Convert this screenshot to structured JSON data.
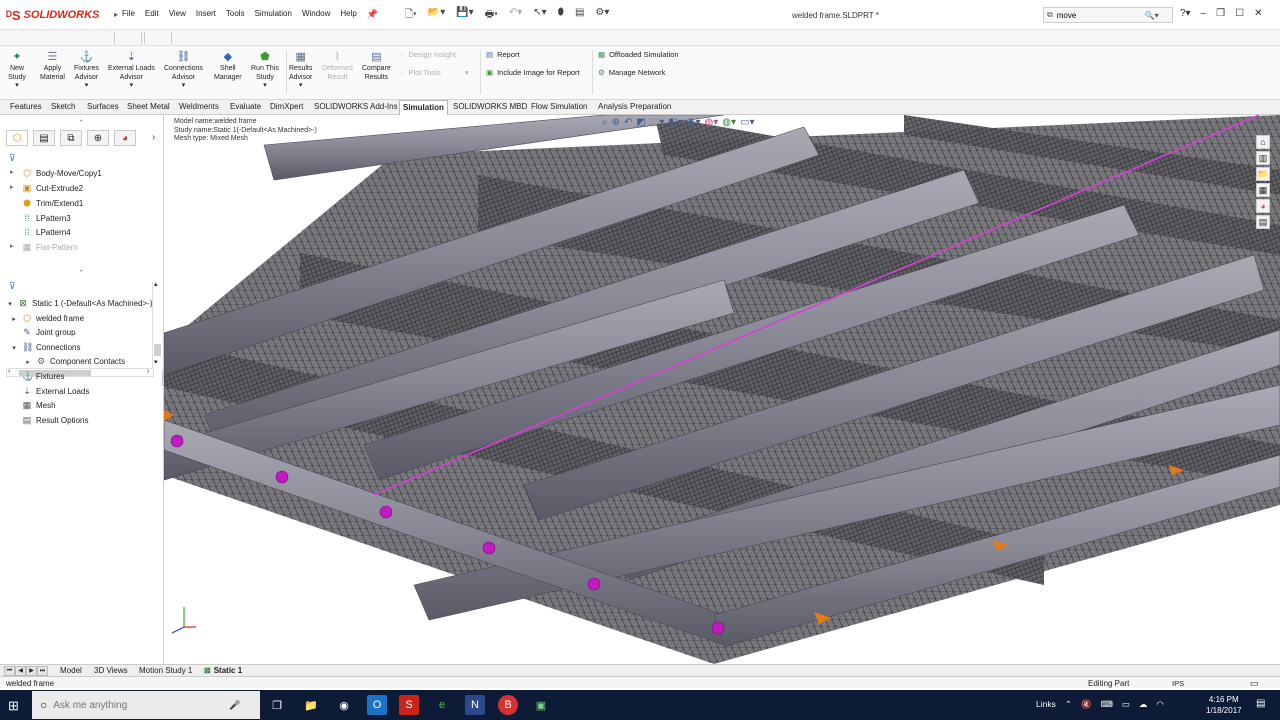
{
  "app": {
    "brand": "SOLIDWORKS",
    "brand_color": "#d52b1e",
    "doc_title": "welded frame.SLDPRT *"
  },
  "menu": [
    "File",
    "Edit",
    "View",
    "Insert",
    "Tools",
    "Simulation",
    "Window",
    "Help"
  ],
  "search": {
    "value": "move"
  },
  "ribbon": {
    "buttons": [
      {
        "label1": "New",
        "label2": "Study",
        "icon": "new-study-icon",
        "disabled": false
      },
      {
        "label1": "Apply",
        "label2": "Material",
        "icon": "apply-material-icon",
        "disabled": false
      },
      {
        "label1": "Fixtures",
        "label2": "Advisor",
        "icon": "fixtures-advisor-icon",
        "disabled": false
      },
      {
        "label1": "External Loads",
        "label2": "Advisor",
        "icon": "external-loads-advisor-icon",
        "disabled": false
      },
      {
        "label1": "Connections",
        "label2": "Advisor",
        "icon": "connections-advisor-icon",
        "disabled": false
      },
      {
        "label1": "Shell",
        "label2": "Manager",
        "icon": "shell-manager-icon",
        "disabled": false
      },
      {
        "label1": "Run This",
        "label2": "Study",
        "icon": "run-study-icon",
        "disabled": false
      },
      {
        "label1": "Results",
        "label2": "Advisor",
        "icon": "results-advisor-icon",
        "disabled": false
      },
      {
        "label1": "Deformed",
        "label2": "Result",
        "icon": "deformed-result-icon",
        "disabled": true
      },
      {
        "label1": "Compare",
        "label2": "Results",
        "icon": "compare-results-icon",
        "disabled": false
      }
    ],
    "small": [
      {
        "label": "Design Insight",
        "icon": "design-insight-icon",
        "disabled": true
      },
      {
        "label": "Plot Tools",
        "icon": "plot-tools-icon",
        "disabled": true
      },
      {
        "label": "Report",
        "icon": "report-icon",
        "disabled": false
      },
      {
        "label": "Include Image for Report",
        "icon": "include-image-icon",
        "disabled": false
      },
      {
        "label": "Offloaded Simulation",
        "icon": "offloaded-simulation-icon",
        "disabled": false
      },
      {
        "label": "Manage Network",
        "icon": "manage-network-icon",
        "disabled": false
      }
    ]
  },
  "tabs": [
    "Features",
    "Sketch",
    "Surfaces",
    "Sheet Metal",
    "Weldments",
    "Evaluate",
    "DimXpert",
    "SOLIDWORKS Add-Ins",
    "Simulation",
    "SOLIDWORKS MBD",
    "Flow Simulation",
    "Analysis Preparation"
  ],
  "tree_features": [
    {
      "label": "Body-Move/Copy1",
      "icon": "body-move-icon",
      "dim": false
    },
    {
      "label": "Cut-Extrude2",
      "icon": "cut-extrude-icon",
      "dim": false
    },
    {
      "label": "Trim/Extend1",
      "icon": "trim-extend-icon",
      "dim": false
    },
    {
      "label": "LPattern3",
      "icon": "linear-pattern-icon",
      "dim": false
    },
    {
      "label": "LPattern4",
      "icon": "linear-pattern-icon",
      "dim": false
    },
    {
      "label": "Flat-Pattern",
      "icon": "flat-pattern-icon",
      "dim": true
    }
  ],
  "tree_sim": [
    {
      "label": "Static 1 (-Default<As Machined>-)",
      "icon": "static-study-icon",
      "indent": 0,
      "toggle": "▾"
    },
    {
      "label": "welded frame",
      "icon": "part-icon",
      "indent": 1,
      "toggle": "▸"
    },
    {
      "label": "Joint group",
      "icon": "joint-group-icon",
      "indent": 1,
      "toggle": ""
    },
    {
      "label": "Connections",
      "icon": "connections-icon",
      "indent": 1,
      "toggle": "▾"
    },
    {
      "label": "Component Contacts",
      "icon": "component-contacts-icon",
      "indent": 2,
      "toggle": "▸"
    },
    {
      "label": "Fixtures",
      "icon": "fixtures-icon",
      "indent": 1,
      "toggle": ""
    },
    {
      "label": "External Loads",
      "icon": "external-loads-icon",
      "indent": 1,
      "toggle": ""
    },
    {
      "label": "Mesh",
      "icon": "mesh-icon",
      "indent": 1,
      "toggle": ""
    },
    {
      "label": "Result Options",
      "icon": "result-options-icon",
      "indent": 1,
      "toggle": ""
    }
  ],
  "viewport": {
    "model_name": "Model name:welded frame",
    "study_name": "Study name:Static 1(-Default<As Machined>-)",
    "mesh_type": "Mesh type: Mixed Mesh"
  },
  "bottom_tabs": [
    "Model",
    "3D Views",
    "Motion Study 1",
    "Static 1"
  ],
  "status": {
    "left": "welded frame",
    "mode": "Editing Part",
    "units": "IPS"
  },
  "taskbar": {
    "search_placeholder": "Ask me anything",
    "links": "Links",
    "time": "4:16 PM",
    "date": "1/18/2017"
  }
}
